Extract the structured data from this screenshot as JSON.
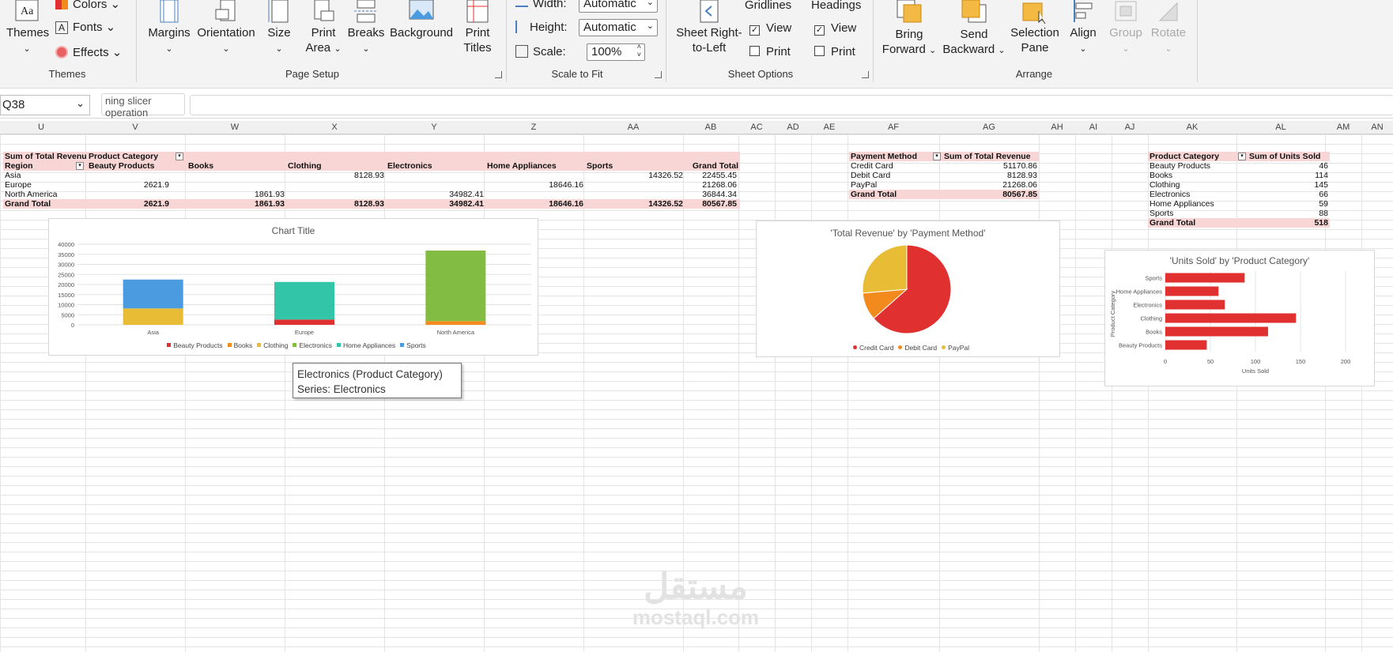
{
  "ribbon": {
    "themes": {
      "themes": "Themes",
      "colors": "Colors",
      "fonts": "Fonts",
      "effects": "Effects",
      "group": "Themes"
    },
    "page_setup": {
      "margins": "Margins",
      "orientation": "Orientation",
      "size": "Size",
      "print_area_1": "Print",
      "print_area_2": "Area",
      "breaks": "Breaks",
      "background": "Background",
      "print_titles_1": "Print",
      "print_titles_2": "Titles",
      "group": "Page Setup"
    },
    "scale_to_fit": {
      "width_label": "Width:",
      "width_value": "Automatic",
      "height_label": "Height:",
      "height_value": "Automatic",
      "scale_label": "Scale:",
      "scale_value": "100%",
      "group": "Scale to Fit"
    },
    "sheet_options": {
      "rtl_1": "Sheet Right-",
      "rtl_2": "to-Left",
      "gridlines": "Gridlines",
      "headings": "Headings",
      "view": "View",
      "print": "Print",
      "group": "Sheet Options"
    },
    "arrange": {
      "bring_forward_1": "Bring",
      "bring_forward_2": "Forward",
      "send_backward_1": "Send",
      "send_backward_2": "Backward",
      "selection_pane_1": "Selection",
      "selection_pane_2": "Pane",
      "align": "Align",
      "group_btn": "Group",
      "rotate": "Rotate",
      "group": "Arrange"
    }
  },
  "formula_bar": {
    "name_box": "Q38",
    "tooltip_text": "ning slicer operation",
    "formula": ""
  },
  "columns": [
    "U",
    "V",
    "W",
    "X",
    "Y",
    "Z",
    "AA",
    "AB",
    "AC",
    "AD",
    "AE",
    "AF",
    "AG",
    "AH",
    "AI",
    "AJ",
    "AK",
    "AL",
    "AM",
    "AN"
  ],
  "pivot1": {
    "corner": "Sum of Total Revenue",
    "col_field": "Product Category",
    "row_field": "Region",
    "headers": [
      "Beauty Products",
      "Books",
      "Clothing",
      "Electronics",
      "Home Appliances",
      "Sports",
      "Grand Total"
    ],
    "rows": [
      {
        "label": "Asia",
        "cells": [
          "",
          "",
          "8128.93",
          "",
          "",
          "14326.52",
          "22455.45"
        ]
      },
      {
        "label": "Europe",
        "cells": [
          "2621.9",
          "",
          "",
          "",
          "18646.16",
          "",
          "21268.06"
        ]
      },
      {
        "label": "North America",
        "cells": [
          "",
          "1861.93",
          "",
          "34982.41",
          "",
          "",
          "36844.34"
        ]
      }
    ],
    "total": {
      "label": "Grand Total",
      "cells": [
        "2621.9",
        "1861.93",
        "8128.93",
        "34982.41",
        "18646.16",
        "14326.52",
        "80567.85"
      ]
    }
  },
  "pivot2": {
    "headers": [
      "Payment Method",
      "Sum of Total Revenue"
    ],
    "rows": [
      [
        "Credit Card",
        "51170.86"
      ],
      [
        "Debit Card",
        "8128.93"
      ],
      [
        "PayPal",
        "21268.06"
      ]
    ],
    "total": [
      "Grand Total",
      "80567.85"
    ]
  },
  "pivot3": {
    "headers": [
      "Product Category",
      "Sum of Units Sold"
    ],
    "rows": [
      [
        "Beauty Products",
        "46"
      ],
      [
        "Books",
        "114"
      ],
      [
        "Clothing",
        "145"
      ],
      [
        "Electronics",
        "66"
      ],
      [
        "Home Appliances",
        "59"
      ],
      [
        "Sports",
        "88"
      ]
    ],
    "total": [
      "Grand Total",
      "518"
    ]
  },
  "chart_data": [
    {
      "type": "bar",
      "stacked": true,
      "title": "Chart Title",
      "categories": [
        "Asia",
        "Europe",
        "North America"
      ],
      "ylim": [
        0,
        40000
      ],
      "yticks": [
        "40000",
        "35000",
        "30000",
        "25000",
        "20000",
        "15000",
        "10000",
        "5000",
        "0"
      ],
      "series": [
        {
          "name": "Beauty Products",
          "color": "#e03030",
          "values": [
            0,
            2621.9,
            0
          ]
        },
        {
          "name": "Books",
          "color": "#f28a1e",
          "values": [
            0,
            0,
            1861.93
          ]
        },
        {
          "name": "Clothing",
          "color": "#e8bd35",
          "values": [
            8128.93,
            0,
            0
          ]
        },
        {
          "name": "Electronics",
          "color": "#82bc42",
          "values": [
            0,
            0,
            34982.41
          ]
        },
        {
          "name": "Home Appliances",
          "color": "#33c5a8",
          "values": [
            0,
            18646.16,
            0
          ]
        },
        {
          "name": "Sports",
          "color": "#4a9be0",
          "values": [
            14326.52,
            0,
            0
          ]
        }
      ],
      "legend": "bottom"
    },
    {
      "type": "pie",
      "title": "'Total Revenue' by 'Payment Method'",
      "categories": [
        "Credit Card",
        "Debit Card",
        "PayPal"
      ],
      "values": [
        51170.86,
        8128.93,
        21268.06
      ],
      "colors": [
        "#e03030",
        "#f28a1e",
        "#e8bd35"
      ],
      "legend": "bottom"
    },
    {
      "type": "bar",
      "orientation": "horizontal",
      "title": "'Units Sold' by 'Product Category'",
      "categories": [
        "Sports",
        "Home Appliances",
        "Electronics",
        "Clothing",
        "Books",
        "Beauty Products"
      ],
      "values": [
        88,
        59,
        66,
        145,
        114,
        46
      ],
      "xlim": [
        0,
        200
      ],
      "xticks": [
        "0",
        "50",
        "100",
        "150",
        "200"
      ],
      "xlabel": "Units Sold",
      "ylabel": "Product Category",
      "color": "#e03030"
    }
  ],
  "tooltip": {
    "line1": "Electronics (Product Category)",
    "line2": "Series: Electronics"
  },
  "watermark": {
    "arabic": "مستقل",
    "latin": "mostaql.com"
  }
}
